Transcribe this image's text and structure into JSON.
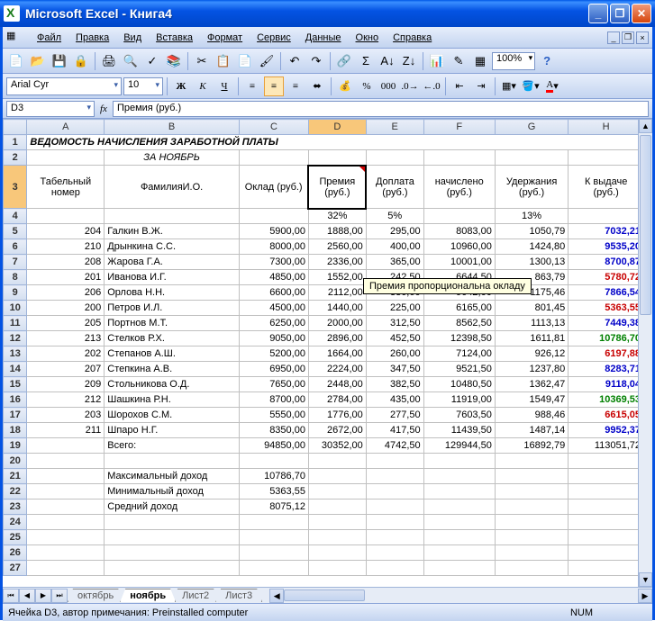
{
  "window": {
    "title": "Microsoft Excel - Книга4"
  },
  "menu": [
    "Файл",
    "Правка",
    "Вид",
    "Вставка",
    "Формат",
    "Сервис",
    "Данные",
    "Окно",
    "Справка"
  ],
  "toolbar": {
    "zoom": "100%"
  },
  "format": {
    "font": "Arial Cyr",
    "size": "10"
  },
  "namebox": "D3",
  "formula": "Премия (руб.)",
  "tooltip": "Премия пропорциональна окладу",
  "cols": [
    "A",
    "B",
    "C",
    "D",
    "E",
    "F",
    "G",
    "H"
  ],
  "title_row": "ВЕДОМОСТЬ НАЧИСЛЕНИЯ ЗАРАБОТНОЙ ПЛАТЫ",
  "subtitle": "ЗА НОЯБРЬ",
  "headers": {
    "A": "Табельный номер",
    "B": "ФамилияИ.О.",
    "C": "Оклад (руб.)",
    "D": "Премия (руб.)",
    "E": "Доплата (руб.)",
    "F": "Всего начислено (руб.)",
    "G": "Удержания (руб.)",
    "H": "К выдаче (руб.)"
  },
  "percents": {
    "D": "32%",
    "E": "5%",
    "G": "13%"
  },
  "rows": [
    {
      "n": "204",
      "name": "Галкин В.Ж.",
      "c": "5900,00",
      "d": "1888,00",
      "e": "295,00",
      "f": "8083,00",
      "g": "1050,79",
      "h": "7032,21",
      "cls": "blue"
    },
    {
      "n": "210",
      "name": "Дрынкина С.С.",
      "c": "8000,00",
      "d": "2560,00",
      "e": "400,00",
      "f": "10960,00",
      "g": "1424,80",
      "h": "9535,20",
      "cls": "blue"
    },
    {
      "n": "208",
      "name": "Жарова Г.А.",
      "c": "7300,00",
      "d": "2336,00",
      "e": "365,00",
      "f": "10001,00",
      "g": "1300,13",
      "h": "8700,87",
      "cls": "blue"
    },
    {
      "n": "201",
      "name": "Иванова И.Г.",
      "c": "4850,00",
      "d": "1552,00",
      "e": "242,50",
      "f": "6644,50",
      "g": "863,79",
      "h": "5780,72",
      "cls": "red"
    },
    {
      "n": "206",
      "name": "Орлова Н.Н.",
      "c": "6600,00",
      "d": "2112,00",
      "e": "330,00",
      "f": "9042,00",
      "g": "1175,46",
      "h": "7866,54",
      "cls": "blue"
    },
    {
      "n": "200",
      "name": "Петров И.Л.",
      "c": "4500,00",
      "d": "1440,00",
      "e": "225,00",
      "f": "6165,00",
      "g": "801,45",
      "h": "5363,55",
      "cls": "red"
    },
    {
      "n": "205",
      "name": "Портнов М.Т.",
      "c": "6250,00",
      "d": "2000,00",
      "e": "312,50",
      "f": "8562,50",
      "g": "1113,13",
      "h": "7449,38",
      "cls": "blue"
    },
    {
      "n": "213",
      "name": "Стелков Р.Х.",
      "c": "9050,00",
      "d": "2896,00",
      "e": "452,50",
      "f": "12398,50",
      "g": "1611,81",
      "h": "10786,70",
      "cls": "green"
    },
    {
      "n": "202",
      "name": "Степанов А.Ш.",
      "c": "5200,00",
      "d": "1664,00",
      "e": "260,00",
      "f": "7124,00",
      "g": "926,12",
      "h": "6197,88",
      "cls": "red"
    },
    {
      "n": "207",
      "name": "Степкина А.В.",
      "c": "6950,00",
      "d": "2224,00",
      "e": "347,50",
      "f": "9521,50",
      "g": "1237,80",
      "h": "8283,71",
      "cls": "blue"
    },
    {
      "n": "209",
      "name": "Стольникова О.Д.",
      "c": "7650,00",
      "d": "2448,00",
      "e": "382,50",
      "f": "10480,50",
      "g": "1362,47",
      "h": "9118,04",
      "cls": "blue"
    },
    {
      "n": "212",
      "name": "Шашкина Р.Н.",
      "c": "8700,00",
      "d": "2784,00",
      "e": "435,00",
      "f": "11919,00",
      "g": "1549,47",
      "h": "10369,53",
      "cls": "green"
    },
    {
      "n": "203",
      "name": "Шорохов С.М.",
      "c": "5550,00",
      "d": "1776,00",
      "e": "277,50",
      "f": "7603,50",
      "g": "988,46",
      "h": "6615,05",
      "cls": "red"
    },
    {
      "n": "211",
      "name": "Шпаро Н.Г.",
      "c": "8350,00",
      "d": "2672,00",
      "e": "417,50",
      "f": "11439,50",
      "g": "1487,14",
      "h": "9952,37",
      "cls": "blue"
    }
  ],
  "totals": {
    "label": "Всего:",
    "c": "94850,00",
    "d": "30352,00",
    "e": "4742,50",
    "f": "129944,50",
    "g": "16892,79",
    "h": "113051,72"
  },
  "stats": [
    {
      "label": "Максимальный доход",
      "value": "10786,70"
    },
    {
      "label": "Минимальный доход",
      "value": "5363,55"
    },
    {
      "label": "Средний доход",
      "value": "8075,12"
    }
  ],
  "sheets": [
    "октябрь",
    "ноябрь",
    "Лист2",
    "Лист3"
  ],
  "active_sheet": 1,
  "status": {
    "left": "Ячейка D3, автор примечания: Preinstalled computer",
    "right": "NUM"
  }
}
